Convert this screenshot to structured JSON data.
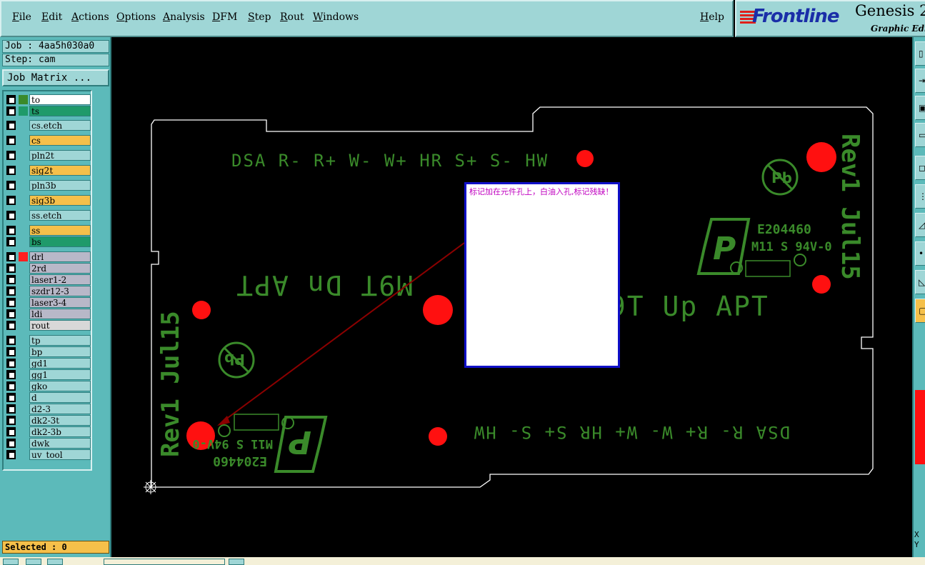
{
  "menu": {
    "items": [
      "File",
      "Edit",
      "Actions",
      "Options",
      "Analysis",
      "DFM",
      "Step",
      "Rout",
      "Windows"
    ],
    "help": "Help"
  },
  "brand": {
    "logo": "Frontline",
    "product": "Genesis 2",
    "subtitle": "Graphic Edit"
  },
  "job": {
    "job_line": "Job : 4aa5h030a0",
    "step_line": "Step: cam",
    "matrix_button": "Job Matrix ..."
  },
  "layers": [
    {
      "name": "to",
      "color": "#ffffff",
      "swatch": "#3a8a2a"
    },
    {
      "name": "ts",
      "color": "#1f9a6a",
      "swatch": "#1f9a6a"
    },
    {
      "name": "cs.etch",
      "color": "#9fd6d6",
      "swatch": ""
    },
    {
      "name": "cs",
      "color": "#f5c04a",
      "swatch": ""
    },
    {
      "name": "pln2t",
      "color": "#9fd6d6",
      "swatch": ""
    },
    {
      "name": "sig2t",
      "color": "#f5c04a",
      "swatch": ""
    },
    {
      "name": "pln3b",
      "color": "#9fd6d6",
      "swatch": ""
    },
    {
      "name": "sig3b",
      "color": "#f5c04a",
      "swatch": ""
    },
    {
      "name": "ss.etch",
      "color": "#9fd6d6",
      "swatch": ""
    },
    {
      "name": "ss",
      "color": "#f5c04a",
      "swatch": ""
    },
    {
      "name": "bs",
      "color": "#1f9a6a",
      "swatch": ""
    },
    {
      "name": "drl",
      "color": "#b8b8c8",
      "swatch": "#ff2020"
    },
    {
      "name": "2rd",
      "color": "#b8b8c8",
      "swatch": ""
    },
    {
      "name": "laser1-2",
      "color": "#b8b8c8",
      "swatch": ""
    },
    {
      "name": "szdr12-3",
      "color": "#b8b8c8",
      "swatch": ""
    },
    {
      "name": "laser3-4",
      "color": "#b8b8c8",
      "swatch": ""
    },
    {
      "name": "ldi",
      "color": "#b8b8c8",
      "swatch": ""
    },
    {
      "name": "rout",
      "color": "#d8d8d8",
      "swatch": ""
    },
    {
      "name": "tp",
      "color": "#9fd6d6",
      "swatch": ""
    },
    {
      "name": "bp",
      "color": "#9fd6d6",
      "swatch": ""
    },
    {
      "name": "gd1",
      "color": "#9fd6d6",
      "swatch": ""
    },
    {
      "name": "gg1",
      "color": "#9fd6d6",
      "swatch": ""
    },
    {
      "name": "gko",
      "color": "#9fd6d6",
      "swatch": ""
    },
    {
      "name": "d",
      "color": "#9fd6d6",
      "swatch": ""
    },
    {
      "name": "d2-3",
      "color": "#9fd6d6",
      "swatch": ""
    },
    {
      "name": "dk2-3t",
      "color": "#9fd6d6",
      "swatch": ""
    },
    {
      "name": "dk2-3b",
      "color": "#9fd6d6",
      "swatch": ""
    },
    {
      "name": "dwk",
      "color": "#9fd6d6",
      "swatch": ""
    },
    {
      "name": "uv_tool",
      "color": "#9fd6d6",
      "swatch": ""
    }
  ],
  "status": {
    "selected": "Selected : 0"
  },
  "coords": {
    "x_label": "X",
    "y_label": "Y"
  },
  "board": {
    "silk_top": "DSA R- R+ W- W+ HR S+ S- HW",
    "silk_bottom": "DSA R- R+ W- W+ HR S+ S- HW",
    "rev_right": "Rev1 Jul15",
    "rev_left": "Rev1 Jul15",
    "up_apt": "M9T Up APT",
    "dn_apt": "M9T Dn APT",
    "ul_code": "E204460",
    "ul_rating": "M11 S 94V-0",
    "pb_mark": "Pb"
  },
  "note": {
    "text": "标记加在元件孔上，白油入孔,标记残缺！"
  },
  "colors": {
    "silk": "#3a8a2a",
    "drill": "#ff1010",
    "outline": "#ffffff",
    "arrow": "#8b0000",
    "note_border": "#1010c8",
    "note_text": "#c000c0"
  }
}
